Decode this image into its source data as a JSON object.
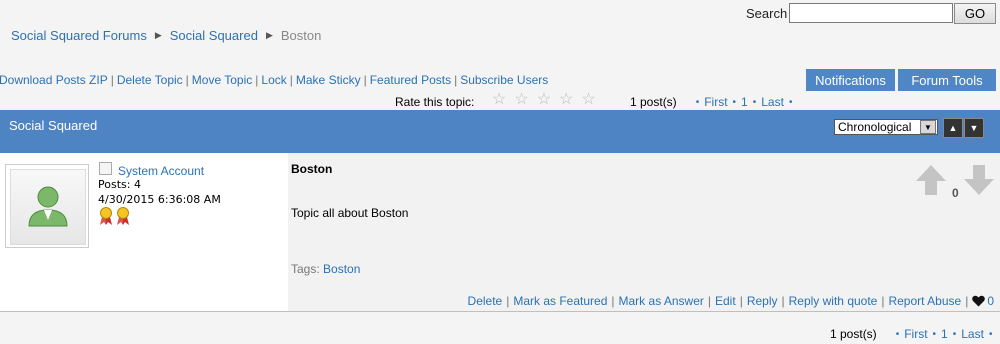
{
  "search": {
    "label": "Search",
    "value": "",
    "button": "GO"
  },
  "breadcrumb": {
    "items": [
      "Social Squared Forums",
      "Social Squared"
    ],
    "current": "Boston"
  },
  "actions": [
    "Download Posts ZIP",
    "Delete Topic",
    "Move Topic",
    "Lock",
    "Make Sticky",
    "Featured Posts",
    "Subscribe Users"
  ],
  "buttons": {
    "notifications": "Notifications",
    "forum_tools": "Forum Tools"
  },
  "rating": {
    "label": "Rate this topic:",
    "stars": 5
  },
  "pager": {
    "count": "1 post(s)",
    "first": "First",
    "page": "1",
    "last": "Last"
  },
  "band": {
    "title": "Social Squared",
    "sort": "Chronological"
  },
  "post": {
    "author": "System Account",
    "posts": "Posts: 4",
    "date": "4/30/2015 6:36:08 AM",
    "title": "Boston",
    "body": "Topic all about Boston",
    "tags_label": "Tags:",
    "tag": "Boston",
    "votes": "0",
    "actions": [
      "Delete",
      "Mark as Featured",
      "Mark as Answer",
      "Edit",
      "Reply",
      "Reply with quote",
      "Report Abuse"
    ],
    "likes": "0"
  }
}
